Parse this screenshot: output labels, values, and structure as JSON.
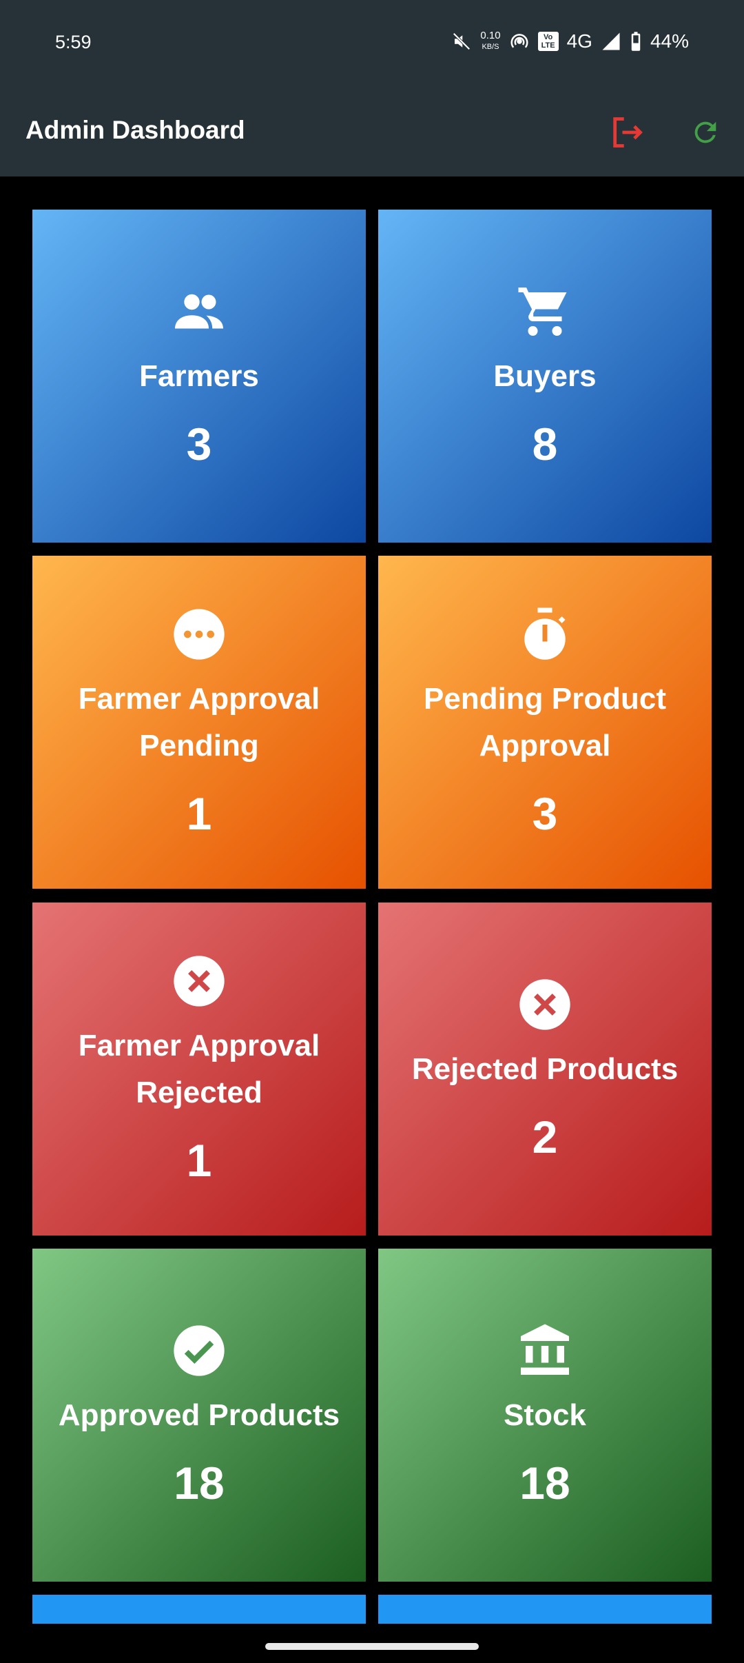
{
  "status_bar": {
    "time": "5:59",
    "net_speed": "0.10",
    "net_unit": "KB/S",
    "volte": "Vo LTE",
    "network": "4G",
    "battery": "44%"
  },
  "app_bar": {
    "title": "Admin Dashboard",
    "logout_icon": "logout-icon",
    "refresh_icon": "refresh-icon",
    "logout_color": "#e53935",
    "refresh_color": "#43a047",
    "background": "#263238"
  },
  "cards": [
    {
      "label": "Farmers",
      "value": "3",
      "icon": "people-icon",
      "color": "blue"
    },
    {
      "label": "Buyers",
      "value": "8",
      "icon": "shopping-cart-icon",
      "color": "blue"
    },
    {
      "label": "Farmer Approval Pending",
      "value": "1",
      "icon": "more-horiz-circle-icon",
      "color": "orange"
    },
    {
      "label": "Pending Product Approval",
      "value": "3",
      "icon": "stopwatch-icon",
      "color": "orange"
    },
    {
      "label": "Farmer Approval Rejected",
      "value": "1",
      "icon": "cancel-circle-icon",
      "color": "red"
    },
    {
      "label": "Rejected Products",
      "value": "2",
      "icon": "cancel-circle-icon",
      "color": "red"
    },
    {
      "label": "Approved Products",
      "value": "18",
      "icon": "check-circle-icon",
      "color": "green"
    },
    {
      "label": "Stock",
      "value": "18",
      "icon": "bank-icon",
      "color": "green"
    }
  ]
}
